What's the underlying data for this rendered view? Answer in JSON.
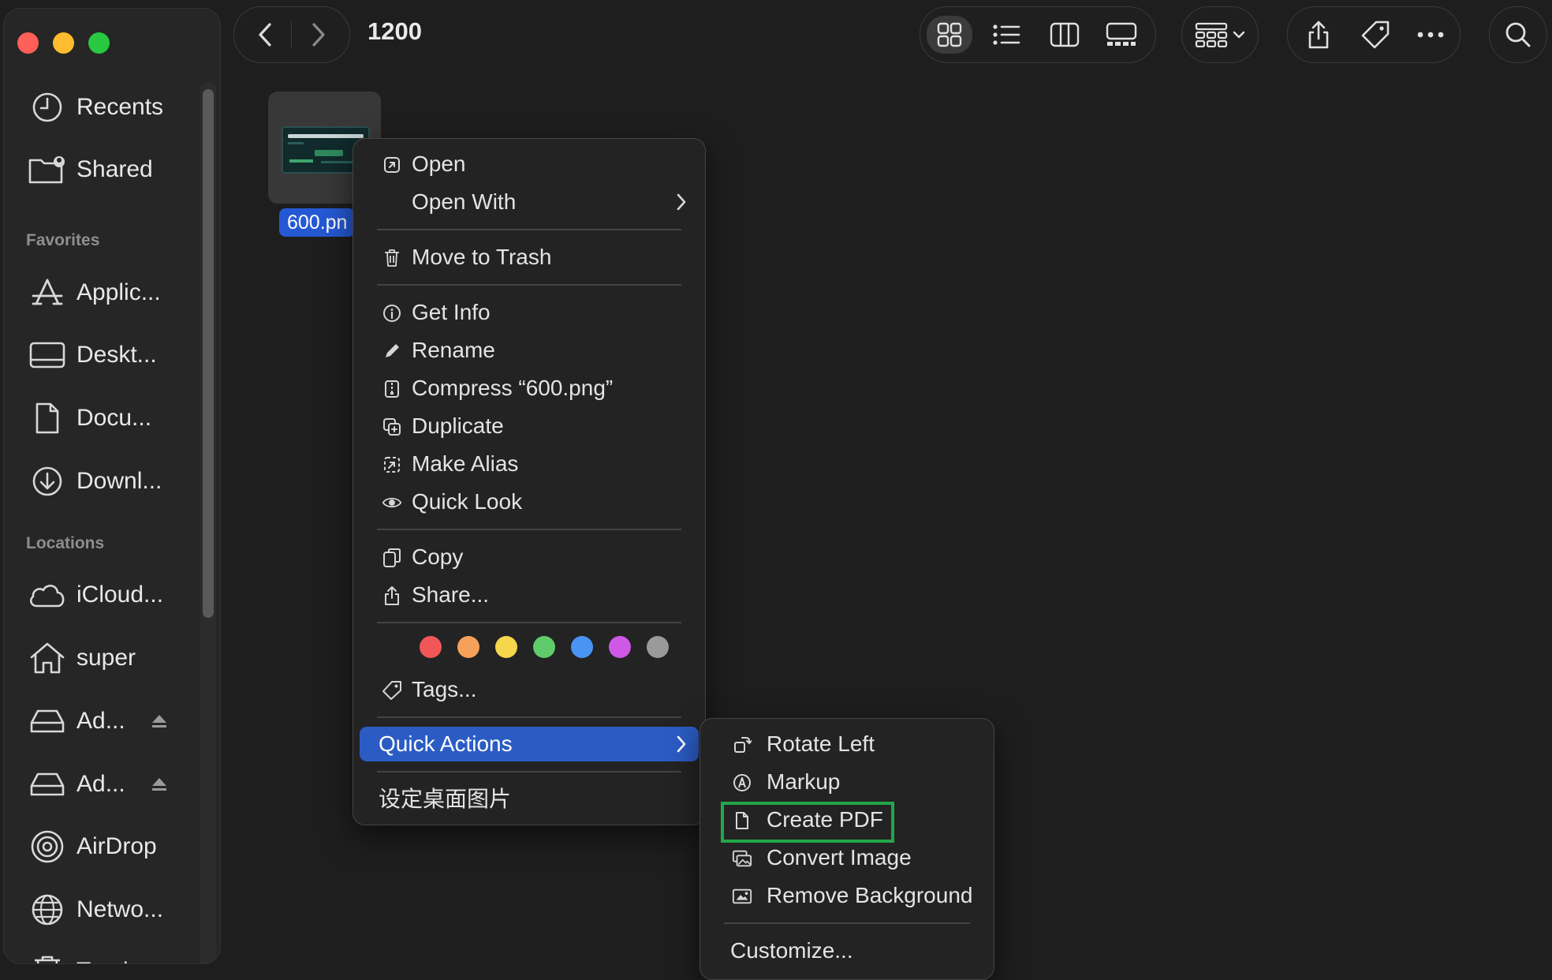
{
  "window": {
    "title": "1200"
  },
  "sidebar": {
    "top_items": [
      {
        "label": "Recents",
        "icon": "clock-icon"
      },
      {
        "label": "Shared",
        "icon": "shared-folder-icon"
      }
    ],
    "favorites_heading": "Favorites",
    "favorites": [
      {
        "label": "Applic...",
        "icon": "applications-icon"
      },
      {
        "label": "Deskt...",
        "icon": "desktop-icon"
      },
      {
        "label": "Docu...",
        "icon": "document-icon"
      },
      {
        "label": "Downl...",
        "icon": "download-icon"
      }
    ],
    "locations_heading": "Locations",
    "locations": [
      {
        "label": "iCloud...",
        "icon": "cloud-icon"
      },
      {
        "label": "super",
        "icon": "home-icon"
      },
      {
        "label": "Ad...",
        "icon": "drive-icon",
        "eject": true
      },
      {
        "label": "Ad...",
        "icon": "drive-icon",
        "eject": true
      },
      {
        "label": "AirDrop",
        "icon": "airdrop-icon"
      },
      {
        "label": "Netwo...",
        "icon": "network-icon"
      },
      {
        "label": "Trash",
        "icon": "trash-icon"
      }
    ]
  },
  "file": {
    "name": "600.pn"
  },
  "context_menu": {
    "open": "Open",
    "open_with": "Open With",
    "move_to_trash": "Move to Trash",
    "get_info": "Get Info",
    "rename": "Rename",
    "compress": "Compress “600.png”",
    "duplicate": "Duplicate",
    "make_alias": "Make Alias",
    "quick_look": "Quick Look",
    "copy": "Copy",
    "share": "Share...",
    "tag_colors": [
      "#f25757",
      "#f5a15a",
      "#f6d64a",
      "#5fcb6a",
      "#4a94f5",
      "#cf59e6",
      "#9a9a9c"
    ],
    "tags": "Tags...",
    "quick_actions": "Quick Actions",
    "set_desktop_picture": "设定桌面图片"
  },
  "quick_actions_menu": {
    "rotate_left": "Rotate Left",
    "markup": "Markup",
    "create_pdf": "Create PDF",
    "convert_image": "Convert Image",
    "remove_background": "Remove Background",
    "customize": "Customize..."
  },
  "colors": {
    "highlight": "#2b5cc4",
    "focus_box": "#22a64a",
    "selection_label": "#2559d4"
  }
}
